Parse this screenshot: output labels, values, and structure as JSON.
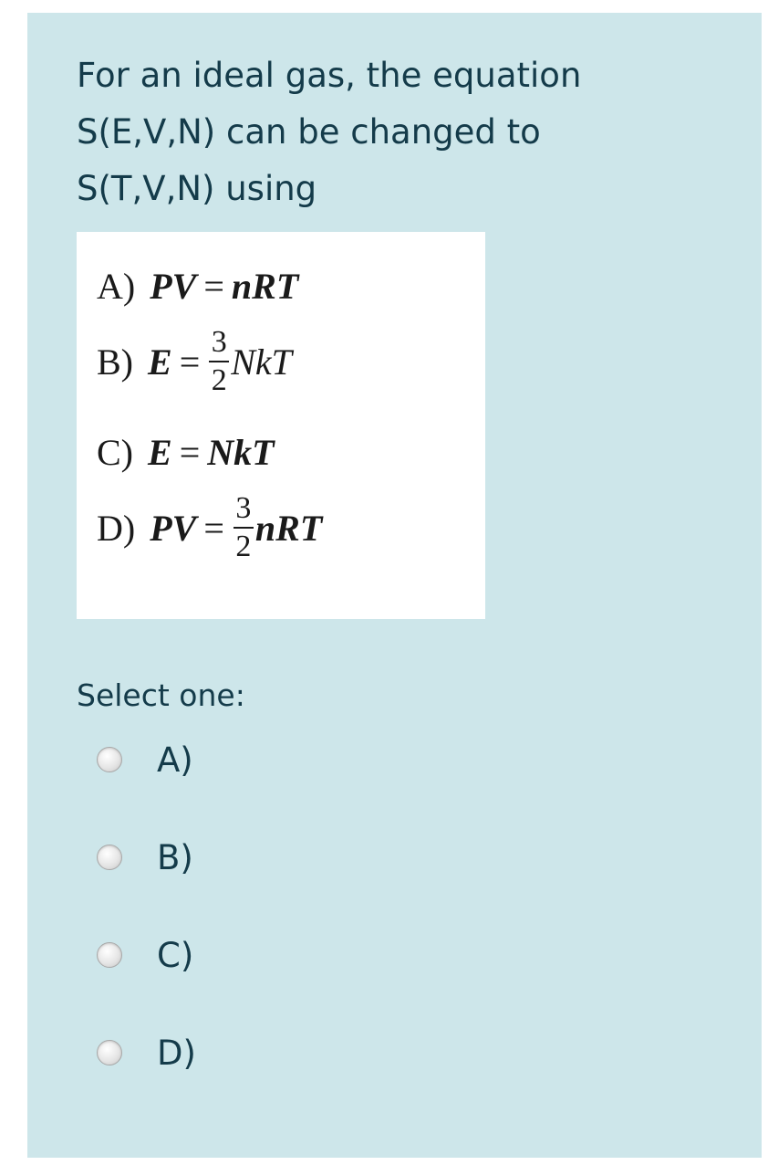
{
  "question": {
    "lines": [
      "For an ideal gas, the equation",
      "S(E,V,N) can be changed to",
      "S(T,V,N) using"
    ]
  },
  "equations": [
    {
      "label": "A)",
      "lhs": "PV",
      "op": "=",
      "rhs": "nRT"
    },
    {
      "label": "B)",
      "lhs": "E",
      "op": "=",
      "num": "3",
      "den": "2",
      "rhs": "NkT"
    },
    {
      "label": "C)",
      "lhs": "E",
      "op": "=",
      "rhs": "NkT"
    },
    {
      "label": "D)",
      "lhs": "PV",
      "op": "=",
      "num": "3",
      "den": "2",
      "rhs": "nRT"
    }
  ],
  "prompt": "Select one:",
  "options": [
    {
      "label": "A)"
    },
    {
      "label": "B)"
    },
    {
      "label": "C)"
    },
    {
      "label": "D)"
    }
  ]
}
